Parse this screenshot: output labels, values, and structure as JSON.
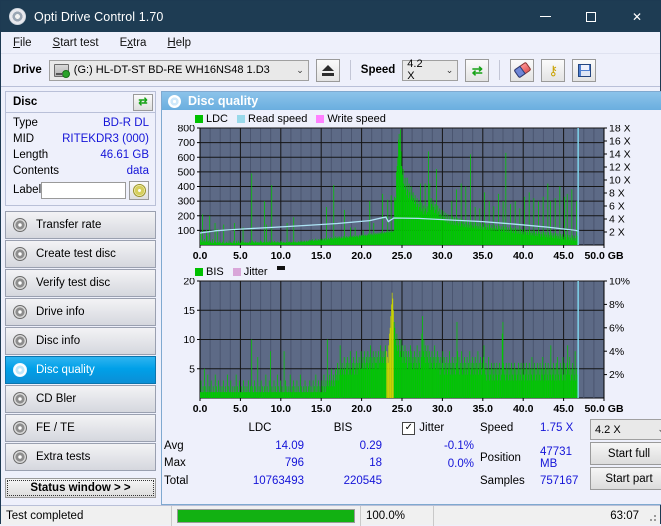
{
  "window": {
    "title": "Opti Drive Control 1.70",
    "icon": "disc-icon",
    "minimize": "–",
    "maximize": "□",
    "close": "✕"
  },
  "menu": [
    {
      "label": "File",
      "accel": "F"
    },
    {
      "label": "Start test",
      "accel": "S"
    },
    {
      "label": "Extra",
      "accel": "x"
    },
    {
      "label": "Help",
      "accel": "H"
    }
  ],
  "toolbar": {
    "drive_label": "Drive",
    "drive_value": "(G:)  HL-DT-ST BD-RE  WH16NS48 1.D3",
    "eject_icon": "eject-icon",
    "speed_label": "Speed",
    "speed_value": "4.2 X",
    "refresh_icon": "refresh-icon",
    "erase_icon": "eraser-icon",
    "key_icon": "key-icon",
    "save_icon": "save-icon",
    "caret": "⌄"
  },
  "disc": {
    "header": "Disc",
    "refresh_icon": "refresh-icon",
    "rows": [
      {
        "key": "Type",
        "value": "BD-R DL"
      },
      {
        "key": "MID",
        "value": "RITEKDR3 (000)"
      },
      {
        "key": "Length",
        "value": "46.61 GB"
      },
      {
        "key": "Contents",
        "value": "data"
      }
    ],
    "label_key": "Label",
    "label_value": "",
    "label_placeholder": "",
    "label_icon": "cd-icon"
  },
  "sidebar": {
    "items": [
      {
        "label": "Transfer rate",
        "icon": "disc-icon",
        "active": false
      },
      {
        "label": "Create test disc",
        "icon": "disc-icon",
        "active": false
      },
      {
        "label": "Verify test disc",
        "icon": "disc-icon",
        "active": false
      },
      {
        "label": "Drive info",
        "icon": "disc-icon",
        "active": false
      },
      {
        "label": "Disc info",
        "icon": "disc-icon",
        "active": false
      },
      {
        "label": "Disc quality",
        "icon": "disc-icon",
        "active": true
      },
      {
        "label": "CD Bler",
        "icon": "disc-icon",
        "active": false
      },
      {
        "label": "FE / TE",
        "icon": "disc-icon",
        "active": false
      },
      {
        "label": "Extra tests",
        "icon": "disc-icon",
        "active": false
      }
    ],
    "status_button": "Status window > >"
  },
  "panel": {
    "title": "Disc quality",
    "icon": "disc-icon"
  },
  "colors": {
    "ldc_green": "#00c000",
    "read_speed_blue": "#99d9ea",
    "write_speed_pink": "#ff80ff",
    "bis_green": "#00c000",
    "jitter_pink": "#d9a6d9",
    "plot_bg": "#5d6a86",
    "accent": "#1414d8",
    "progress_green": "#12b112",
    "titlebar": "#1e3c53"
  },
  "chart_data": [
    {
      "type": "area",
      "title": "Disc quality - LDC",
      "xlabel": "GB",
      "ylabel": "LDC",
      "xlim": [
        0,
        50
      ],
      "ylim": [
        0,
        800
      ],
      "y2lim": [
        0,
        18
      ],
      "y2label": "X",
      "xticks": [
        "0.0",
        "5.0",
        "10.0",
        "15.0",
        "20.0",
        "25.0",
        "30.0",
        "35.0",
        "40.0",
        "45.0",
        "50.0 GB"
      ],
      "yticks": [
        100,
        200,
        300,
        400,
        500,
        600,
        700,
        800
      ],
      "y2ticks": [
        "2 X",
        "4 X",
        "6 X",
        "8 X",
        "10 X",
        "12 X",
        "14 X",
        "16 X",
        "18 X"
      ],
      "grid": true,
      "legend_position": "top-left",
      "legend": [
        {
          "name": "LDC",
          "color": "#00c000"
        },
        {
          "name": "Read speed",
          "color": "#99d9ea"
        },
        {
          "name": "Write speed",
          "color": "#ff80ff"
        }
      ],
      "data_end_x": 46.8,
      "ldc_samples": [
        80,
        35,
        20,
        210,
        18,
        30,
        40,
        18,
        25,
        105,
        60,
        22,
        30,
        14,
        200,
        25,
        18,
        12,
        40,
        16,
        14,
        30,
        150,
        20,
        12,
        18,
        110,
        20,
        14,
        30,
        18,
        10,
        14,
        22,
        12,
        140,
        10,
        16,
        12,
        22,
        12,
        16,
        14,
        30,
        12,
        18,
        20,
        14,
        12,
        16,
        28,
        150,
        14,
        12,
        30,
        18,
        14,
        30,
        20,
        12,
        16,
        14,
        30,
        20,
        120,
        18,
        14,
        22,
        16,
        12,
        20,
        16,
        14,
        18,
        25,
        14,
        16,
        490,
        30,
        18,
        22,
        14,
        18,
        28,
        14,
        20,
        18,
        16,
        22,
        14,
        30,
        18,
        25,
        14,
        18,
        20,
        300,
        22,
        14,
        140,
        18,
        22,
        16,
        30,
        20,
        14,
        18,
        410,
        24,
        16,
        20,
        28,
        14,
        22,
        18,
        16,
        24,
        18,
        20,
        14,
        16,
        28,
        20,
        14,
        18,
        22,
        16,
        18,
        14,
        20,
        150,
        16,
        22,
        18,
        24,
        14,
        18,
        20,
        16,
        22,
        190,
        20,
        16,
        24,
        18,
        14,
        20,
        26,
        18,
        22,
        24,
        18,
        30,
        20,
        26,
        22,
        30,
        24,
        18,
        30,
        26,
        22,
        30,
        24,
        36,
        30,
        26,
        34,
        40,
        30,
        26,
        34,
        28,
        44,
        30,
        36,
        28,
        40,
        30,
        36,
        42,
        30,
        36,
        44,
        30,
        36,
        42,
        48,
        30,
        260,
        40,
        36,
        50,
        42,
        36,
        48,
        54,
        40,
        46,
        36,
        410,
        50,
        44,
        60,
        50,
        44,
        56,
        48,
        60,
        52,
        44,
        50,
        58,
        44,
        50,
        62,
        240,
        54,
        48,
        60,
        50,
        56,
        48,
        62,
        54,
        120,
        60,
        52,
        58,
        66,
        54,
        60,
        120,
        54,
        60,
        66,
        58,
        50,
        62,
        70,
        58,
        64,
        70,
        62,
        100,
        68,
        62,
        72,
        66,
        60,
        72,
        66,
        78,
        68,
        300,
        74,
        66,
        80,
        72,
        66,
        150,
        74,
        82,
        70,
        76,
        84,
        72,
        78,
        86,
        74,
        80,
        88,
        76,
        350,
        84,
        78,
        90,
        80,
        86,
        92,
        84,
        310,
        90,
        84,
        96,
        88,
        340,
        92,
        86,
        100,
        94,
        330,
        300,
        320,
        500,
        540,
        600,
        720,
        760,
        700,
        790,
        640,
        540,
        480,
        520,
        420,
        380,
        460,
        400,
        340,
        460,
        380,
        320,
        420,
        360,
        310,
        400,
        340,
        300,
        360,
        320,
        280,
        340,
        300,
        260,
        320,
        280,
        240,
        300,
        260,
        420,
        230,
        290,
        250,
        210,
        270,
        230,
        420,
        250,
        210,
        265,
        225,
        640,
        300,
        420,
        240,
        320,
        280,
        240,
        300,
        260,
        220,
        280,
        240,
        520,
        210,
        270,
        230,
        190,
        250,
        210,
        180,
        240,
        200,
        170,
        230,
        190,
        160,
        220,
        180,
        150,
        210,
        170,
        145,
        200,
        165,
        140,
        300,
        195,
        160,
        138,
        190,
        155,
        135,
        380,
        185,
        150,
        132,
        180,
        148,
        128,
        420,
        175,
        145,
        125,
        170,
        142,
        122,
        400,
        168,
        140,
        120,
        165,
        138,
        118,
        620,
        160,
        135,
        116,
        158,
        132,
        114,
        260,
        155,
        130,
        112,
        152,
        128,
        110,
        250,
        150,
        126,
        108,
        148,
        124,
        106,
        360,
        145,
        122,
        104,
        142,
        120,
        102,
        300,
        140,
        118,
        100,
        138,
        116,
        98,
        265,
        135,
        114,
        96,
        132,
        112,
        94,
        350,
        130,
        110,
        92,
        128,
        108,
        90,
        300,
        125,
        106,
        88,
        630,
        122,
        104,
        86,
        120,
        102,
        84,
        280,
        118,
        100,
        82,
        116,
        98,
        80,
        300,
        114,
        96,
        78,
        112,
        94,
        76,
        250,
        110,
        92,
        74,
        108,
        90,
        72,
        330,
        106,
        88,
        70,
        104,
        86,
        68,
        360,
        102,
        84,
        66,
        100,
        82,
        64,
        320,
        98,
        80,
        62,
        96,
        78,
        60,
        300,
        94,
        76,
        58,
        92,
        74,
        56,
        330,
        90,
        72,
        54,
        88,
        70,
        52,
        420,
        86,
        68,
        50,
        300,
        84,
        66,
        48,
        82,
        64,
        46,
        320,
        80,
        62,
        44,
        78,
        60,
        42,
        400,
        76,
        58,
        40,
        74,
        56,
        38,
        330,
        72,
        54,
        36,
        350,
        70,
        52,
        34,
        68,
        50,
        32,
        380,
        66,
        48,
        30,
        64,
        46,
        28,
        300,
        62,
        44
      ],
      "read_speed_series": [
        {
          "x": 0,
          "y": 1.85
        },
        {
          "x": 2,
          "y": 2.2
        },
        {
          "x": 5,
          "y": 2.45
        },
        {
          "x": 9,
          "y": 2.7
        },
        {
          "x": 13,
          "y": 3.0
        },
        {
          "x": 17,
          "y": 3.3
        },
        {
          "x": 21,
          "y": 3.75
        },
        {
          "x": 23,
          "y": 4.3
        },
        {
          "x": 23.3,
          "y": 3.6
        },
        {
          "x": 24,
          "y": 4.15
        },
        {
          "x": 27,
          "y": 4.1
        },
        {
          "x": 31,
          "y": 3.85
        },
        {
          "x": 35,
          "y": 3.6
        },
        {
          "x": 39,
          "y": 3.2
        },
        {
          "x": 43,
          "y": 2.75
        },
        {
          "x": 46.5,
          "y": 2.25
        },
        {
          "x": 46.9,
          "y": 2.1
        }
      ]
    },
    {
      "type": "area",
      "title": "Disc quality - BIS / Jitter",
      "xlabel": "GB",
      "ylabel": "BIS",
      "xlim": [
        0,
        50
      ],
      "ylim": [
        0,
        20
      ],
      "y2lim": [
        0,
        10
      ],
      "y2label": "%",
      "xticks": [
        "0.0",
        "5.0",
        "10.0",
        "15.0",
        "20.0",
        "25.0",
        "30.0",
        "35.0",
        "40.0",
        "45.0",
        "50.0 GB"
      ],
      "yticks": [
        5,
        10,
        15,
        20
      ],
      "y2ticks": [
        "2%",
        "4%",
        "6%",
        "8%",
        "10%"
      ],
      "grid": true,
      "legend_position": "top-left",
      "legend": [
        {
          "name": "BIS",
          "color": "#00c000"
        },
        {
          "name": "Jitter",
          "color": "#d9a6d9"
        }
      ],
      "data_end_x": 46.8,
      "bis_samples": [
        1,
        3,
        1,
        1,
        2,
        1,
        5,
        1,
        2,
        1,
        1,
        4,
        1,
        2,
        1,
        1,
        3,
        1,
        1,
        2,
        1,
        1,
        4,
        1,
        2,
        1,
        1,
        3,
        1,
        2,
        1,
        1,
        2,
        1,
        3,
        1,
        1,
        2,
        1,
        1,
        4,
        1,
        2,
        1,
        1,
        3,
        1,
        1,
        2,
        1,
        1,
        2,
        1,
        4,
        1,
        2,
        1,
        1,
        3,
        1,
        1,
        2,
        1,
        1,
        3,
        1,
        2,
        1,
        1,
        2,
        1,
        3,
        1,
        1,
        2,
        1,
        10,
        2,
        1,
        1,
        3,
        1,
        2,
        1,
        1,
        7,
        1,
        2,
        1,
        1,
        3,
        1,
        2,
        1,
        1,
        2,
        1,
        4,
        1,
        2,
        1,
        1,
        3,
        1,
        8,
        1,
        2,
        1,
        1,
        3,
        1,
        2,
        1,
        1,
        4,
        1,
        2,
        1,
        1,
        3,
        1,
        2,
        1,
        1,
        8,
        1,
        3,
        1,
        2,
        1,
        1,
        2,
        1,
        4,
        1,
        1,
        2,
        1,
        3,
        1,
        2,
        1,
        1,
        3,
        1,
        2,
        1,
        1,
        4,
        1,
        2,
        1,
        1,
        2,
        1,
        3,
        1,
        2,
        1,
        1,
        2,
        1,
        3,
        1,
        2,
        1,
        1,
        3,
        1,
        2,
        1,
        4,
        1,
        2,
        1,
        3,
        1,
        2,
        1,
        1,
        3,
        2,
        1,
        4,
        2,
        1,
        3,
        2,
        10,
        3,
        2,
        4,
        3,
        2,
        5,
        3,
        2,
        4,
        3,
        2,
        5,
        3,
        4,
        6,
        3,
        5,
        4,
        9,
        5,
        4,
        6,
        5,
        4,
        7,
        5,
        4,
        6,
        5,
        7,
        4,
        6,
        5,
        8,
        5,
        4,
        6,
        5,
        7,
        4,
        6,
        5,
        8,
        4,
        6,
        5,
        7,
        6,
        5,
        8,
        5,
        6,
        7,
        5,
        8,
        6,
        5,
        7,
        6,
        8,
        5,
        7,
        6,
        9,
        5,
        7,
        6,
        8,
        5,
        7,
        6,
        8,
        6,
        7,
        5,
        8,
        6,
        7,
        9,
        6,
        8,
        7,
        6,
        8,
        7,
        9,
        6,
        8,
        7,
        6,
        9,
        11,
        12,
        14,
        16,
        18,
        17,
        15,
        13,
        12,
        10,
        9,
        11,
        8,
        10,
        9,
        7,
        8,
        10,
        7,
        9,
        6,
        8,
        7,
        9,
        6,
        8,
        7,
        5,
        8,
        6,
        7,
        9,
        6,
        8,
        5,
        7,
        6,
        8,
        5,
        7,
        6,
        9,
        5,
        7,
        6,
        8,
        5,
        7,
        11,
        14,
        8,
        10,
        7,
        9,
        6,
        8,
        7,
        9,
        6,
        8,
        5,
        7,
        6,
        8,
        5,
        7,
        6,
        9,
        5,
        7,
        6,
        8,
        5,
        7,
        6,
        4,
        7,
        5,
        6,
        8,
        5,
        7,
        4,
        6,
        5,
        7,
        4,
        6,
        5,
        8,
        4,
        6,
        5,
        7,
        4,
        6,
        5,
        7,
        4,
        6,
        13,
        8,
        5,
        7,
        4,
        6,
        5,
        8,
        4,
        6,
        5,
        7,
        4,
        6,
        5,
        7,
        4,
        6,
        5,
        8,
        4,
        6,
        5,
        7,
        4,
        6,
        5,
        7,
        4,
        6,
        5,
        8,
        4,
        6,
        5,
        7,
        4,
        6,
        5,
        7,
        9,
        5,
        4,
        6,
        3,
        5,
        4,
        7,
        3,
        5,
        4,
        6,
        3,
        5,
        4,
        6,
        3,
        5,
        4,
        6,
        3,
        5,
        4,
        6,
        3,
        5,
        4,
        11,
        13,
        6,
        4,
        5,
        3,
        6,
        4,
        5,
        3,
        6,
        4,
        5,
        3,
        6,
        4,
        5,
        3,
        6,
        4,
        5,
        3,
        5,
        4,
        6,
        3,
        5,
        4,
        6,
        3,
        5,
        4,
        6,
        3,
        5,
        4,
        6,
        3,
        5,
        4,
        6,
        3,
        5,
        4,
        7,
        3,
        5,
        4,
        6,
        3,
        5,
        4,
        6,
        3,
        5,
        4,
        6,
        3,
        5,
        4,
        7,
        3,
        5,
        4,
        6,
        3,
        5,
        4,
        6,
        3,
        5,
        4,
        9,
        3,
        5,
        4,
        6,
        3,
        5,
        4,
        6,
        3,
        7,
        4,
        5,
        3,
        6,
        4,
        5,
        3,
        7,
        4,
        6,
        3,
        5,
        4,
        6,
        9,
        5,
        4,
        7,
        3,
        5,
        4,
        6,
        3,
        5,
        4,
        8,
        3,
        5,
        4,
        6
      ],
      "jitter_peak_x": 23.5
    }
  ],
  "stats": {
    "columns": [
      "LDC",
      "BIS"
    ],
    "jitter_label": "Jitter",
    "jitter_checked": true,
    "rows": [
      {
        "label": "Avg",
        "ldc": "14.09",
        "bis": "0.29",
        "jitter": "-0.1%"
      },
      {
        "label": "Max",
        "ldc": "796",
        "bis": "18",
        "jitter": "0.0%"
      },
      {
        "label": "Total",
        "ldc": "10763493",
        "bis": "220545",
        "jitter": ""
      }
    ],
    "speed_label": "Speed",
    "speed_value": "1.75 X",
    "position_label": "Position",
    "position_value": "47731 MB",
    "samples_label": "Samples",
    "samples_value": "757167",
    "speed_select": "4.2 X",
    "start_full": "Start full",
    "start_part": "Start part",
    "caret": "⌄"
  },
  "statusbar": {
    "message": "Test completed",
    "progress_percent": "100.0%",
    "progress_value": 100,
    "elapsed": "63:07"
  }
}
